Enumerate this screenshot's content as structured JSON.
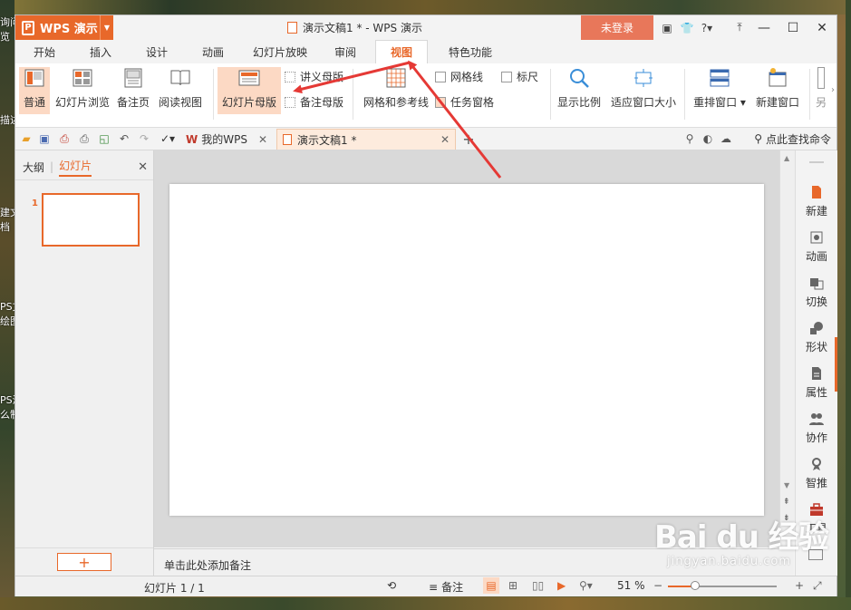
{
  "desktop": {
    "side_texts": [
      "询问",
      "览",
      "描述",
      "建文",
      "档",
      "PS文",
      "绘图",
      "PS演",
      "么制"
    ]
  },
  "window": {
    "app_name": "WPS 演示",
    "title": "演示文稿1 * - WPS 演示",
    "login_label": "未登录",
    "help_label": "?"
  },
  "tabs": [
    {
      "label": "开始"
    },
    {
      "label": "插入"
    },
    {
      "label": "设计"
    },
    {
      "label": "动画"
    },
    {
      "label": "幻灯片放映"
    },
    {
      "label": "审阅"
    },
    {
      "label": "视图"
    },
    {
      "label": "特色功能"
    }
  ],
  "active_tab": "视图",
  "ribbon": {
    "normal": "普通",
    "slide_browse": "幻灯片浏览",
    "notes_page": "备注页",
    "reading_view": "阅读视图",
    "slide_master": "幻灯片母版",
    "handout_master": "讲义母版",
    "notes_master": "备注母版",
    "grid_guides": "网格和参考线",
    "gridlines": "网格线",
    "ruler": "标尺",
    "task_pane": "任务窗格",
    "zoom": "显示比例",
    "fit_window": "适应窗口大小",
    "arrange_window": "重排窗口",
    "new_window": "新建窗口",
    "more_cut": "另"
  },
  "doc_tabs": [
    {
      "label": "我的WPS"
    },
    {
      "label": "演示文稿1 *"
    }
  ],
  "search_label": "点此查找命令",
  "left_pane": {
    "tab_outline": "大纲",
    "tab_slides": "幻灯片",
    "slide_number": "1",
    "add_label": "+"
  },
  "notes_placeholder": "单击此处添加备注",
  "right_pane": [
    {
      "label": "新建",
      "color": "#e8682a"
    },
    {
      "label": "动画",
      "color": "#666666"
    },
    {
      "label": "切换",
      "color": "#666666"
    },
    {
      "label": "形状",
      "color": "#666666"
    },
    {
      "label": "属性",
      "color": "#666666"
    },
    {
      "label": "协作",
      "color": "#666666"
    },
    {
      "label": "智推",
      "color": "#666666"
    },
    {
      "label": "工具",
      "color": "#c0392b"
    }
  ],
  "status": {
    "slide_info": "幻灯片 1 / 1",
    "notes_label": "备注",
    "zoom_percent": "51 %",
    "zoom_value": 51
  },
  "watermark": {
    "logo": "Bai du 经验",
    "url": "jingyan.baidu.com"
  },
  "colors": {
    "accent": "#e8682a",
    "arrow": "#e53935"
  }
}
